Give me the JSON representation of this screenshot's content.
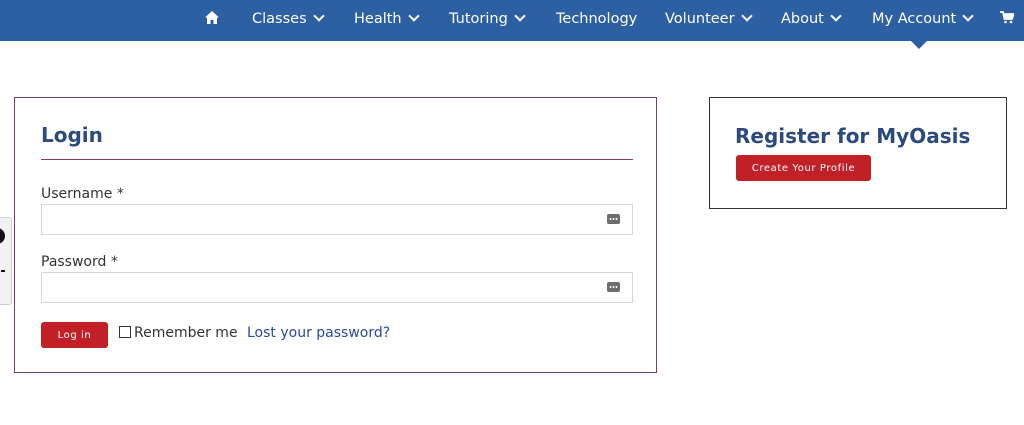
{
  "nav": {
    "home_icon": "home-icon",
    "items": [
      {
        "label": "Classes",
        "dropdown": true
      },
      {
        "label": "Health",
        "dropdown": true
      },
      {
        "label": "Tutoring",
        "dropdown": true
      },
      {
        "label": "Technology",
        "dropdown": false
      },
      {
        "label": "Volunteer",
        "dropdown": true
      },
      {
        "label": "About",
        "dropdown": true
      },
      {
        "label": "My Account",
        "dropdown": true
      }
    ],
    "cart_icon": "cart-icon",
    "background_color": "#2d5fa3"
  },
  "login": {
    "title": "Login",
    "username_label": "Username *",
    "username_value": "",
    "password_label": "Password *",
    "password_value": "",
    "login_button": "Log in",
    "remember_label": "Remember me",
    "remember_checked": false,
    "lost_password_link": "Lost your password?"
  },
  "register": {
    "title": "Register for MyOasis",
    "create_button": "Create Your Profile"
  },
  "colors": {
    "heading": "#2c4a7d",
    "button": "#c12026",
    "link": "#2c4a9d",
    "box_border": "#7b3b6e"
  }
}
